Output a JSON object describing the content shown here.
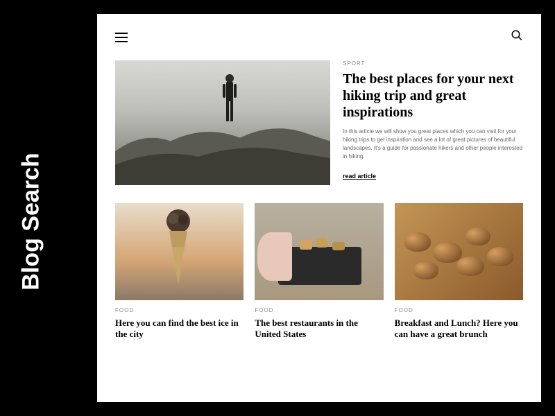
{
  "page_label": "Blog Search",
  "hero": {
    "category": "SPORT",
    "title": "The best places for your next hiking trip and great inspirations",
    "description": "In this article we will show you great places which you can visit for your hiking trips to get inspiration and see a lot of great pictures of beautiful landscapes. It's a guide for passionate hikers and other people interested in hiking.",
    "read_label": "read article"
  },
  "articles": [
    {
      "category": "FOOD",
      "title": "Here you can find the best ice in the city"
    },
    {
      "category": "FOOD",
      "title": "The best restaurants in the United States"
    },
    {
      "category": "FOOD",
      "title": "Breakfast and Lunch? Here you can have a great brunch"
    }
  ]
}
